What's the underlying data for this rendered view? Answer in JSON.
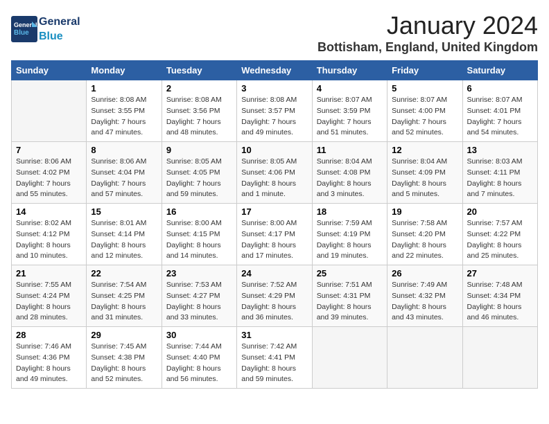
{
  "header": {
    "logo_general": "General",
    "logo_blue": "Blue",
    "month_title": "January 2024",
    "location": "Bottisham, England, United Kingdom"
  },
  "days_of_week": [
    "Sunday",
    "Monday",
    "Tuesday",
    "Wednesday",
    "Thursday",
    "Friday",
    "Saturday"
  ],
  "weeks": [
    [
      {
        "day": "",
        "info": ""
      },
      {
        "day": "1",
        "info": "Sunrise: 8:08 AM\nSunset: 3:55 PM\nDaylight: 7 hours\nand 47 minutes."
      },
      {
        "day": "2",
        "info": "Sunrise: 8:08 AM\nSunset: 3:56 PM\nDaylight: 7 hours\nand 48 minutes."
      },
      {
        "day": "3",
        "info": "Sunrise: 8:08 AM\nSunset: 3:57 PM\nDaylight: 7 hours\nand 49 minutes."
      },
      {
        "day": "4",
        "info": "Sunrise: 8:07 AM\nSunset: 3:59 PM\nDaylight: 7 hours\nand 51 minutes."
      },
      {
        "day": "5",
        "info": "Sunrise: 8:07 AM\nSunset: 4:00 PM\nDaylight: 7 hours\nand 52 minutes."
      },
      {
        "day": "6",
        "info": "Sunrise: 8:07 AM\nSunset: 4:01 PM\nDaylight: 7 hours\nand 54 minutes."
      }
    ],
    [
      {
        "day": "7",
        "info": "Sunrise: 8:06 AM\nSunset: 4:02 PM\nDaylight: 7 hours\nand 55 minutes."
      },
      {
        "day": "8",
        "info": "Sunrise: 8:06 AM\nSunset: 4:04 PM\nDaylight: 7 hours\nand 57 minutes."
      },
      {
        "day": "9",
        "info": "Sunrise: 8:05 AM\nSunset: 4:05 PM\nDaylight: 7 hours\nand 59 minutes."
      },
      {
        "day": "10",
        "info": "Sunrise: 8:05 AM\nSunset: 4:06 PM\nDaylight: 8 hours\nand 1 minute."
      },
      {
        "day": "11",
        "info": "Sunrise: 8:04 AM\nSunset: 4:08 PM\nDaylight: 8 hours\nand 3 minutes."
      },
      {
        "day": "12",
        "info": "Sunrise: 8:04 AM\nSunset: 4:09 PM\nDaylight: 8 hours\nand 5 minutes."
      },
      {
        "day": "13",
        "info": "Sunrise: 8:03 AM\nSunset: 4:11 PM\nDaylight: 8 hours\nand 7 minutes."
      }
    ],
    [
      {
        "day": "14",
        "info": "Sunrise: 8:02 AM\nSunset: 4:12 PM\nDaylight: 8 hours\nand 10 minutes."
      },
      {
        "day": "15",
        "info": "Sunrise: 8:01 AM\nSunset: 4:14 PM\nDaylight: 8 hours\nand 12 minutes."
      },
      {
        "day": "16",
        "info": "Sunrise: 8:00 AM\nSunset: 4:15 PM\nDaylight: 8 hours\nand 14 minutes."
      },
      {
        "day": "17",
        "info": "Sunrise: 8:00 AM\nSunset: 4:17 PM\nDaylight: 8 hours\nand 17 minutes."
      },
      {
        "day": "18",
        "info": "Sunrise: 7:59 AM\nSunset: 4:19 PM\nDaylight: 8 hours\nand 19 minutes."
      },
      {
        "day": "19",
        "info": "Sunrise: 7:58 AM\nSunset: 4:20 PM\nDaylight: 8 hours\nand 22 minutes."
      },
      {
        "day": "20",
        "info": "Sunrise: 7:57 AM\nSunset: 4:22 PM\nDaylight: 8 hours\nand 25 minutes."
      }
    ],
    [
      {
        "day": "21",
        "info": "Sunrise: 7:55 AM\nSunset: 4:24 PM\nDaylight: 8 hours\nand 28 minutes."
      },
      {
        "day": "22",
        "info": "Sunrise: 7:54 AM\nSunset: 4:25 PM\nDaylight: 8 hours\nand 31 minutes."
      },
      {
        "day": "23",
        "info": "Sunrise: 7:53 AM\nSunset: 4:27 PM\nDaylight: 8 hours\nand 33 minutes."
      },
      {
        "day": "24",
        "info": "Sunrise: 7:52 AM\nSunset: 4:29 PM\nDaylight: 8 hours\nand 36 minutes."
      },
      {
        "day": "25",
        "info": "Sunrise: 7:51 AM\nSunset: 4:31 PM\nDaylight: 8 hours\nand 39 minutes."
      },
      {
        "day": "26",
        "info": "Sunrise: 7:49 AM\nSunset: 4:32 PM\nDaylight: 8 hours\nand 43 minutes."
      },
      {
        "day": "27",
        "info": "Sunrise: 7:48 AM\nSunset: 4:34 PM\nDaylight: 8 hours\nand 46 minutes."
      }
    ],
    [
      {
        "day": "28",
        "info": "Sunrise: 7:46 AM\nSunset: 4:36 PM\nDaylight: 8 hours\nand 49 minutes."
      },
      {
        "day": "29",
        "info": "Sunrise: 7:45 AM\nSunset: 4:38 PM\nDaylight: 8 hours\nand 52 minutes."
      },
      {
        "day": "30",
        "info": "Sunrise: 7:44 AM\nSunset: 4:40 PM\nDaylight: 8 hours\nand 56 minutes."
      },
      {
        "day": "31",
        "info": "Sunrise: 7:42 AM\nSunset: 4:41 PM\nDaylight: 8 hours\nand 59 minutes."
      },
      {
        "day": "",
        "info": ""
      },
      {
        "day": "",
        "info": ""
      },
      {
        "day": "",
        "info": ""
      }
    ]
  ]
}
